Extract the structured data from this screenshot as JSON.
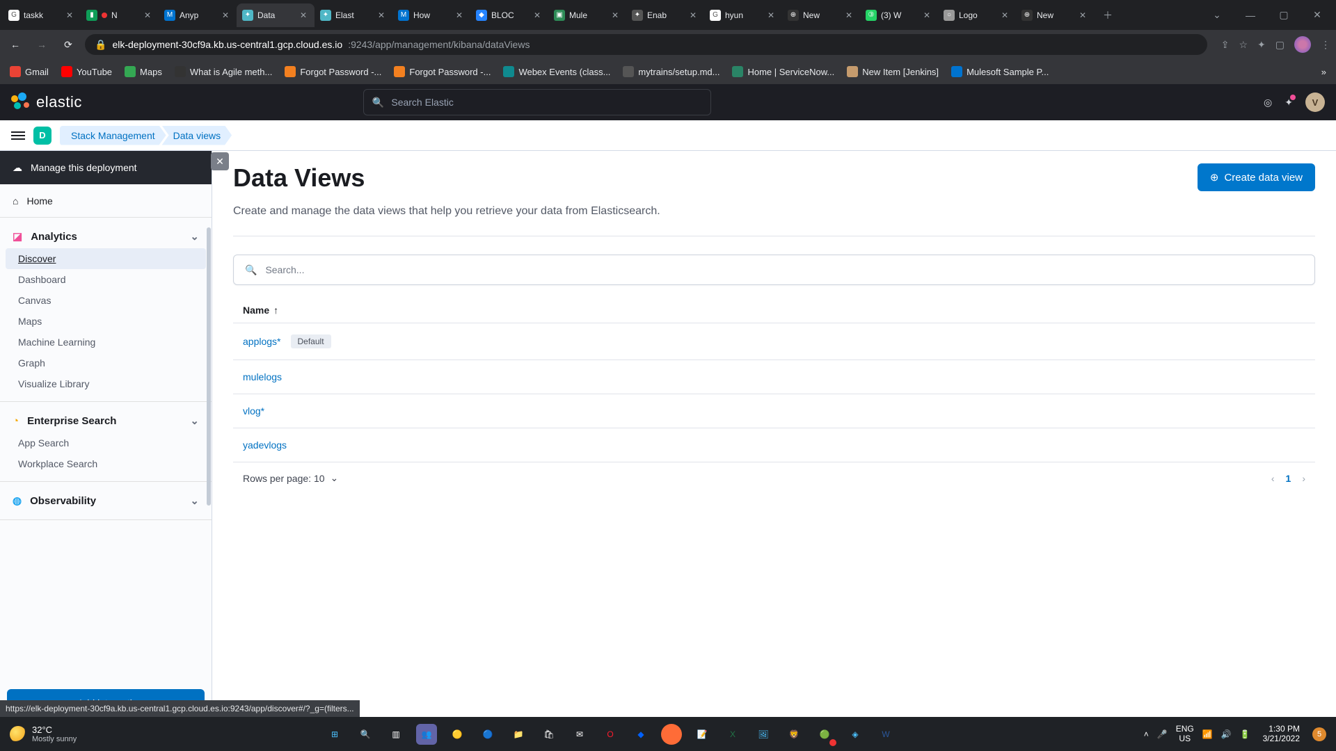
{
  "browser": {
    "tabs": [
      {
        "title": "taskk",
        "favicon_bg": "#fff",
        "favicon_txt": "G"
      },
      {
        "title": "N",
        "favicon_bg": "#0f9d58",
        "favicon_txt": "▮",
        "recording": true
      },
      {
        "title": "Anyp",
        "favicon_bg": "#0073cf",
        "favicon_txt": "M"
      },
      {
        "title": "Data",
        "favicon_bg": "#4fb7c6",
        "favicon_txt": "✦",
        "active": true
      },
      {
        "title": "Elast",
        "favicon_bg": "#4fb7c6",
        "favicon_txt": "✦"
      },
      {
        "title": "How",
        "favicon_bg": "#0073cf",
        "favicon_txt": "M"
      },
      {
        "title": "BLOC",
        "favicon_bg": "#2684ff",
        "favicon_txt": "◆"
      },
      {
        "title": "Mule",
        "favicon_bg": "#2e8b57",
        "favicon_txt": "▣"
      },
      {
        "title": "Enab",
        "favicon_bg": "#555",
        "favicon_txt": "✦"
      },
      {
        "title": "hyun",
        "favicon_bg": "#fff",
        "favicon_txt": "G"
      },
      {
        "title": "New",
        "favicon_bg": "#333",
        "favicon_txt": "⊕"
      },
      {
        "title": "(3) W",
        "favicon_bg": "#25d366",
        "favicon_txt": "③"
      },
      {
        "title": "Logo",
        "favicon_bg": "#999",
        "favicon_txt": "○"
      },
      {
        "title": "New",
        "favicon_bg": "#333",
        "favicon_txt": "⊕"
      }
    ],
    "url_host": "elk-deployment-30cf9a.kb.us-central1.gcp.cloud.es.io",
    "url_port_path": ":9243/app/management/kibana/dataViews",
    "bookmarks": [
      {
        "label": "Gmail",
        "bg": "#ea4335"
      },
      {
        "label": "YouTube",
        "bg": "#ff0000"
      },
      {
        "label": "Maps",
        "bg": "#34a853"
      },
      {
        "label": "What is Agile meth...",
        "bg": "#333"
      },
      {
        "label": "Forgot Password -...",
        "bg": "#f38020"
      },
      {
        "label": "Forgot Password -...",
        "bg": "#f38020"
      },
      {
        "label": "Webex Events (class...",
        "bg": "#0f8a8f"
      },
      {
        "label": "mytrains/setup.md...",
        "bg": "#555"
      },
      {
        "label": "Home | ServiceNow...",
        "bg": "#2a8466"
      },
      {
        "label": "New Item [Jenkins]",
        "bg": "#c59b6d"
      },
      {
        "label": "Mulesoft Sample P...",
        "bg": "#0073cf"
      }
    ],
    "status_url": "https://elk-deployment-30cf9a.kb.us-central1.gcp.cloud.es.io:9243/app/discover#/?_g=(filters..."
  },
  "elastic_header": {
    "brand": "elastic",
    "search_placeholder": "Search Elastic",
    "avatar_letter": "V",
    "space_letter": "D",
    "breadcrumbs": [
      "Stack Management",
      "Data views"
    ]
  },
  "sidebar": {
    "manage_label": "Manage this deployment",
    "home_label": "Home",
    "groups": [
      {
        "title": "Analytics",
        "items": [
          "Discover",
          "Dashboard",
          "Canvas",
          "Maps",
          "Machine Learning",
          "Graph",
          "Visualize Library"
        ],
        "active_index": 0
      },
      {
        "title": "Enterprise Search",
        "items": [
          "App Search",
          "Workplace Search"
        ]
      },
      {
        "title": "Observability",
        "items": []
      }
    ],
    "add_integrations_label": "Add integrations"
  },
  "page": {
    "title": "Data Views",
    "description": "Create and manage the data views that help you retrieve your data from Elasticsearch.",
    "create_label": "Create data view",
    "search_placeholder": "Search...",
    "column_header": "Name",
    "rows": [
      {
        "name": "applogs*",
        "default": true
      },
      {
        "name": "mulelogs"
      },
      {
        "name": "vlog*"
      },
      {
        "name": "yadevlogs"
      }
    ],
    "default_badge": "Default",
    "rows_per_page_label": "Rows per page: 10",
    "current_page": "1"
  },
  "system": {
    "weather_temp": "32°C",
    "weather_desc": "Mostly sunny",
    "lang_top": "ENG",
    "lang_bot": "US",
    "time": "1:30 PM",
    "date": "3/21/2022",
    "notif_count": "5"
  }
}
